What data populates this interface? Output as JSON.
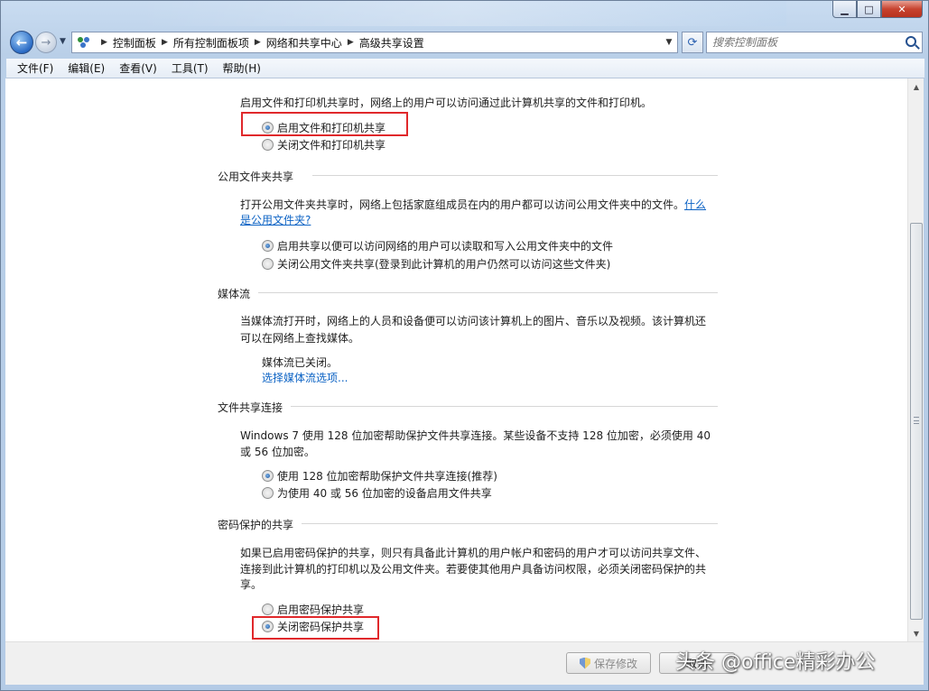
{
  "window": {
    "caption": {
      "min": "▁",
      "max": "□",
      "close": "✕"
    }
  },
  "nav": {
    "back_icon": "←",
    "fwd_icon": "→",
    "breadcrumbs": [
      "控制面板",
      "所有控制面板项",
      "网络和共享中心",
      "高级共享设置"
    ],
    "search_placeholder": "搜索控制面板"
  },
  "menu": [
    "文件(F)",
    "编辑(E)",
    "查看(V)",
    "工具(T)",
    "帮助(H)"
  ],
  "sections": {
    "file_print": {
      "description": "启用文件和打印机共享时，网络上的用户可以访问通过此计算机共享的文件和打印机。",
      "options": [
        "启用文件和打印机共享",
        "关闭文件和打印机共享"
      ],
      "selected": 0
    },
    "public_folder": {
      "title": "公用文件夹共享",
      "description": "打开公用文件夹共享时，网络上包括家庭组成员在内的用户都可以访问公用文件夹中的文件。",
      "link": "什么是公用文件夹?",
      "link_part1": "什么",
      "link_part2": "是公用文件夹?",
      "options": [
        "启用共享以便可以访问网络的用户可以读取和写入公用文件夹中的文件",
        "关闭公用文件夹共享(登录到此计算机的用户仍然可以访问这些文件夹)"
      ],
      "selected": 0
    },
    "media": {
      "title": "媒体流",
      "description_line1": "当媒体流打开时，网络上的人员和设备便可以访问该计算机上的图片、音乐以及视频。该计算机还",
      "description_line2": "可以在网络上查找媒体。",
      "status": "媒体流已关闭。",
      "link": "选择媒体流选项..."
    },
    "file_sharing_conn": {
      "title": "文件共享连接",
      "description_line1": "Windows 7 使用 128 位加密帮助保护文件共享连接。某些设备不支持 128 位加密，必须使用 40",
      "description_line2": "或 56 位加密。",
      "options": [
        "使用 128 位加密帮助保护文件共享连接(推荐)",
        "为使用 40 或 56 位加密的设备启用文件共享"
      ],
      "selected": 0
    },
    "password": {
      "title": "密码保护的共享",
      "description_line1": "如果已启用密码保护的共享，则只有具备此计算机的用户帐户和密码的用户才可以访问共享文件、",
      "description_line2": "连接到此计算机的打印机以及公用文件夹。若要使其他用户具备访问权限，必须关闭密码保护的共",
      "description_line3": "享。",
      "options": [
        "启用密码保护共享",
        "关闭密码保护共享"
      ],
      "selected": 1
    }
  },
  "buttons": {
    "save": "保存修改",
    "cancel": "取消"
  },
  "watermark": "头条 @office精彩办公"
}
